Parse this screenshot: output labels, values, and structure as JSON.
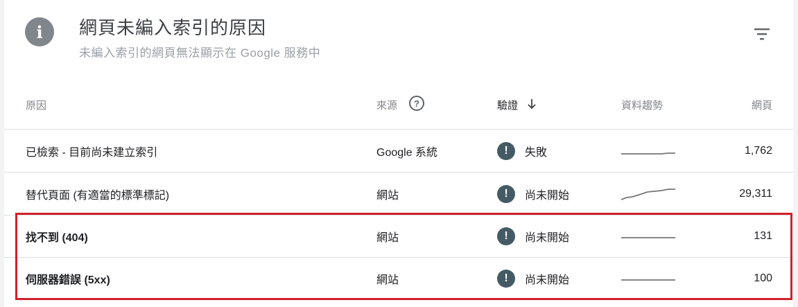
{
  "card": {
    "title": "網頁未編入索引的原因",
    "subtitle": "未編入索引的網頁無法顯示在 Google 服務中"
  },
  "table": {
    "headers": {
      "reason": "原因",
      "source": "來源",
      "validation": "驗證",
      "trend": "資料趨勢",
      "pages": "網頁"
    },
    "rows": [
      {
        "reason": "已檢索 - 目前尚未建立索引",
        "source": "Google 系統",
        "status": "失敗",
        "pages": "1,762"
      },
      {
        "reason": "替代頁面 (有適當的標準標記)",
        "source": "網站",
        "status": "尚未開始",
        "pages": "29,311"
      },
      {
        "reason": "找不到 (404)",
        "source": "網站",
        "status": "尚未開始",
        "pages": "131"
      },
      {
        "reason": "伺服器錯誤 (5xx)",
        "source": "網站",
        "status": "尚未開始",
        "pages": "100"
      }
    ]
  },
  "colors": {
    "highlight_border": "#d0202a",
    "status_icon": "#455a64",
    "sparkline": "#757575"
  }
}
